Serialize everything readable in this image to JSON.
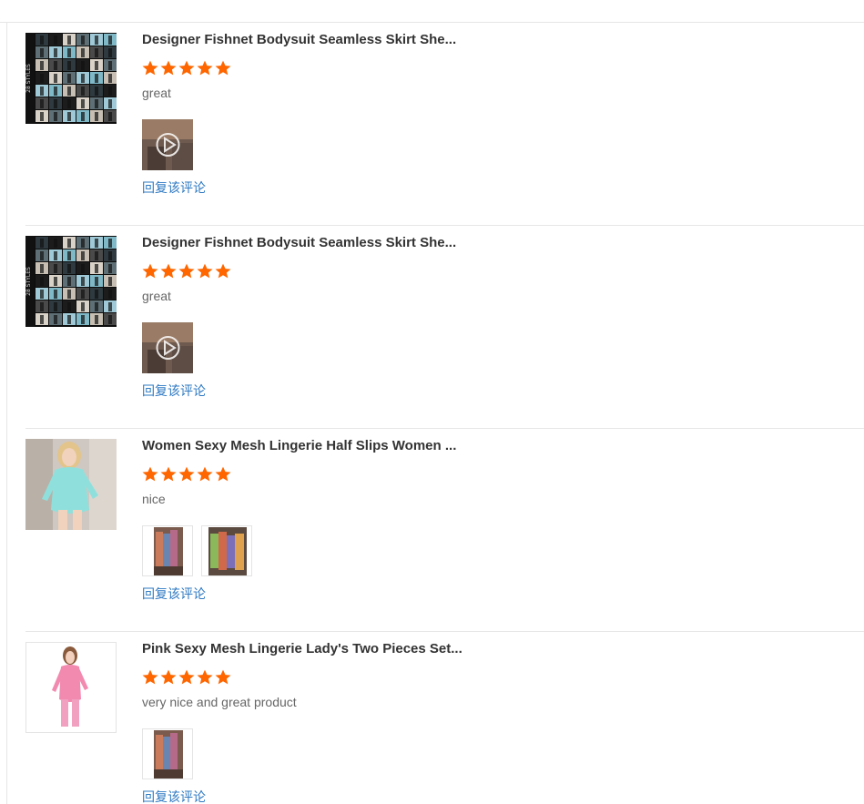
{
  "reviews": [
    {
      "title": "Designer Fishnet Bodysuit Seamless Skirt She...",
      "rating": 5,
      "comment": "great",
      "reply_label": "回复该评论",
      "product_image": "fishnet-catalog-grid",
      "product_image_text": "28 STYLES",
      "media": [
        "video-thumbnail"
      ]
    },
    {
      "title": "Designer Fishnet Bodysuit Seamless Skirt She...",
      "rating": 5,
      "comment": "great",
      "reply_label": "回复该评论",
      "product_image": "fishnet-catalog-grid",
      "product_image_text": "28 STYLES",
      "media": [
        "video-thumbnail"
      ]
    },
    {
      "title": "Women Sexy Mesh Lingerie Half Slips Women ...",
      "rating": 5,
      "comment": "nice",
      "reply_label": "回复该评论",
      "product_image": "model-in-mint-mesh-dress",
      "media": [
        "photo-garments-rack",
        "photo-garments-colorful"
      ]
    },
    {
      "title": "Pink Sexy Mesh Lingerie Lady's Two Pieces Set...",
      "rating": 5,
      "comment": "very nice and great product",
      "reply_label": "回复该评论",
      "product_image": "model-in-pink-mesh-set",
      "media": [
        "photo-garments-rack"
      ]
    }
  ],
  "colors": {
    "star": "#ff6600",
    "link": "#2e79c2",
    "title": "#333333",
    "comment": "#666666",
    "divider": "#e6e6e6"
  }
}
